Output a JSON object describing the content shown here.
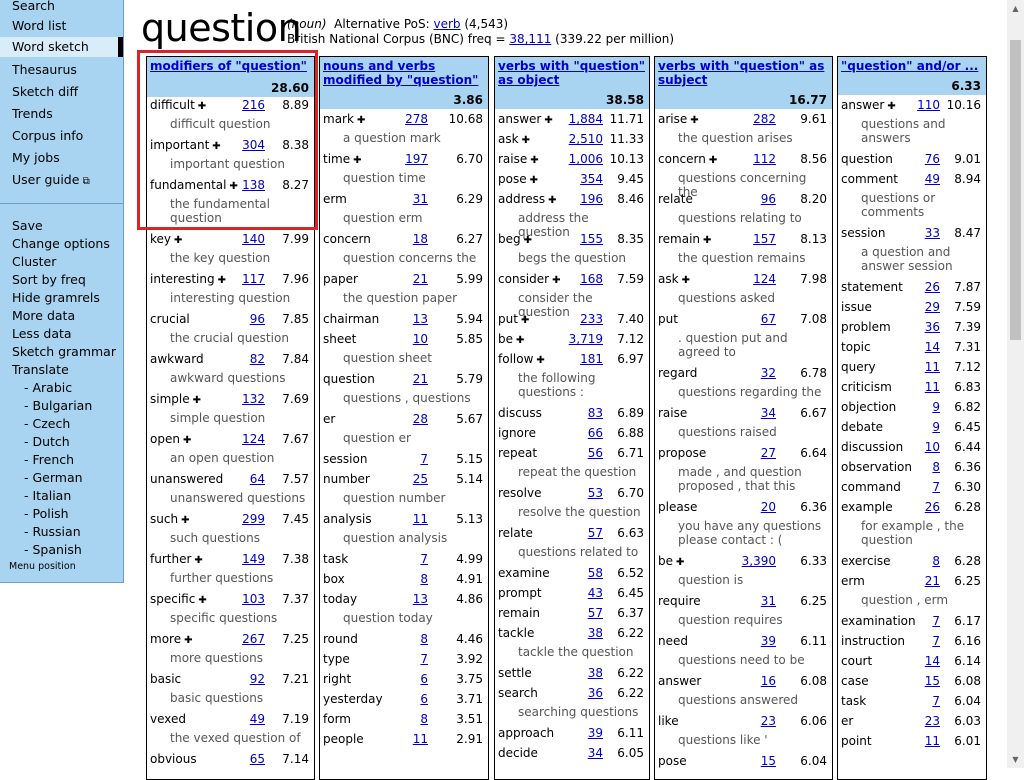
{
  "sidebar": {
    "top_items": [
      "Search",
      "Word list",
      "Word sketch",
      "Thesaurus",
      "Sketch diff",
      "Trends",
      "Corpus info",
      "My jobs",
      "User guide"
    ],
    "active": "Word sketch",
    "bottom_items": [
      "Save",
      "Change options",
      "Cluster",
      "Sort by freq",
      "Hide gramrels",
      "More data",
      "Less data",
      "Sketch grammar",
      "Translate"
    ],
    "languages": [
      "- Arabic",
      "- Bulgarian",
      "- Czech",
      "- Dutch",
      "- French",
      "- German",
      "- Italian",
      "- Polish",
      "- Russian",
      "- Spanish"
    ],
    "menu_position": "Menu position"
  },
  "header": {
    "headword": "question",
    "pos": "(noun)",
    "alt_pos_label": "Alternative PoS:",
    "alt_pos_link": "verb",
    "alt_pos_count": "(4,543)",
    "corpus_label": "British National Corpus (BNC) freq =",
    "freq": "38,111",
    "per_million": "(339.22 per million)"
  },
  "columns": [
    {
      "title": "modifiers of \"question\"",
      "score": "28.60",
      "rows": [
        {
          "word": "difficult",
          "plus": true,
          "freq": "216",
          "score": "8.89",
          "ex": "difficult question"
        },
        {
          "word": "important",
          "plus": true,
          "freq": "304",
          "score": "8.38",
          "ex": "important question"
        },
        {
          "word": "fundamental",
          "plus": true,
          "freq": "138",
          "score": "8.27",
          "ex": "the fundamental question"
        },
        {
          "word": "key",
          "plus": true,
          "freq": "140",
          "score": "7.99",
          "ex": "the key question"
        },
        {
          "word": "interesting",
          "plus": true,
          "freq": "117",
          "score": "7.96",
          "ex": "interesting question"
        },
        {
          "word": "crucial",
          "plus": false,
          "freq": "96",
          "score": "7.85",
          "ex": "the crucial question"
        },
        {
          "word": "awkward",
          "plus": false,
          "freq": "82",
          "score": "7.84",
          "ex": "awkward questions"
        },
        {
          "word": "simple",
          "plus": true,
          "freq": "132",
          "score": "7.69",
          "ex": "simple question"
        },
        {
          "word": "open",
          "plus": true,
          "freq": "124",
          "score": "7.67",
          "ex": "an open question"
        },
        {
          "word": "unanswered",
          "plus": false,
          "freq": "64",
          "score": "7.57",
          "ex": "unanswered questions ."
        },
        {
          "word": "such",
          "plus": true,
          "freq": "299",
          "score": "7.45",
          "ex": "such questions"
        },
        {
          "word": "further",
          "plus": true,
          "freq": "149",
          "score": "7.38",
          "ex": "further questions"
        },
        {
          "word": "specific",
          "plus": true,
          "freq": "103",
          "score": "7.37",
          "ex": "specific questions"
        },
        {
          "word": "more",
          "plus": true,
          "freq": "267",
          "score": "7.25",
          "ex": "more questions"
        },
        {
          "word": "basic",
          "plus": false,
          "freq": "92",
          "score": "7.21",
          "ex": "basic questions"
        },
        {
          "word": "vexed",
          "plus": false,
          "freq": "49",
          "score": "7.19",
          "ex": "the vexed question of"
        },
        {
          "word": "obvious",
          "plus": false,
          "freq": "65",
          "score": "7.14",
          "ex": ""
        }
      ]
    },
    {
      "title": "nouns and verbs modified by \"question\"",
      "score": "3.86",
      "rows": [
        {
          "word": "mark",
          "plus": true,
          "freq": "278",
          "score": "10.68",
          "ex": "a question mark"
        },
        {
          "word": "time",
          "plus": true,
          "freq": "197",
          "score": "6.70",
          "ex": "question time"
        },
        {
          "word": "erm",
          "plus": false,
          "freq": "31",
          "score": "6.29",
          "ex": "question erm"
        },
        {
          "word": "concern",
          "plus": false,
          "freq": "18",
          "score": "6.27",
          "ex": "question concerns the"
        },
        {
          "word": "paper",
          "plus": false,
          "freq": "21",
          "score": "5.99",
          "ex": "the question paper"
        },
        {
          "word": "chairman",
          "plus": false,
          "freq": "13",
          "score": "5.94",
          "ex": ""
        },
        {
          "word": "sheet",
          "plus": false,
          "freq": "10",
          "score": "5.85",
          "ex": "question sheet"
        },
        {
          "word": "question",
          "plus": false,
          "freq": "21",
          "score": "5.79",
          "ex": "questions , questions"
        },
        {
          "word": "er",
          "plus": false,
          "freq": "28",
          "score": "5.67",
          "ex": "question er"
        },
        {
          "word": "session",
          "plus": false,
          "freq": "7",
          "score": "5.15",
          "ex": ""
        },
        {
          "word": "number",
          "plus": false,
          "freq": "25",
          "score": "5.14",
          "ex": "question number"
        },
        {
          "word": "analysis",
          "plus": false,
          "freq": "11",
          "score": "5.13",
          "ex": "question analysis"
        },
        {
          "word": "task",
          "plus": false,
          "freq": "7",
          "score": "4.99",
          "ex": ""
        },
        {
          "word": "box",
          "plus": false,
          "freq": "8",
          "score": "4.91",
          "ex": ""
        },
        {
          "word": "today",
          "plus": false,
          "freq": "13",
          "score": "4.86",
          "ex": "question today"
        },
        {
          "word": "round",
          "plus": false,
          "freq": "8",
          "score": "4.46",
          "ex": ""
        },
        {
          "word": "type",
          "plus": false,
          "freq": "7",
          "score": "3.92",
          "ex": ""
        },
        {
          "word": "right",
          "plus": false,
          "freq": "6",
          "score": "3.75",
          "ex": ""
        },
        {
          "word": "yesterday",
          "plus": false,
          "freq": "6",
          "score": "3.71",
          "ex": ""
        },
        {
          "word": "form",
          "plus": false,
          "freq": "8",
          "score": "3.51",
          "ex": ""
        },
        {
          "word": "people",
          "plus": false,
          "freq": "11",
          "score": "2.91",
          "ex": ""
        }
      ]
    },
    {
      "title": "verbs with \"question\" as object",
      "score": "38.58",
      "rows": [
        {
          "word": "answer",
          "plus": true,
          "freq": "1,884",
          "score": "11.71",
          "ex": ""
        },
        {
          "word": "ask",
          "plus": true,
          "freq": "2,510",
          "score": "11.33",
          "ex": ""
        },
        {
          "word": "raise",
          "plus": true,
          "freq": "1,006",
          "score": "10.13",
          "ex": ""
        },
        {
          "word": "pose",
          "plus": true,
          "freq": "354",
          "score": "9.45",
          "ex": ""
        },
        {
          "word": "address",
          "plus": true,
          "freq": "196",
          "score": "8.46",
          "ex": "address the question"
        },
        {
          "word": "beg",
          "plus": true,
          "freq": "155",
          "score": "8.35",
          "ex": "begs the question"
        },
        {
          "word": "consider",
          "plus": true,
          "freq": "168",
          "score": "7.59",
          "ex": "consider the question"
        },
        {
          "word": "put",
          "plus": true,
          "freq": "233",
          "score": "7.40",
          "ex": ""
        },
        {
          "word": "be",
          "plus": true,
          "freq": "3,719",
          "score": "7.12",
          "ex": ""
        },
        {
          "word": "follow",
          "plus": true,
          "freq": "181",
          "score": "6.97",
          "ex": "the following questions :"
        },
        {
          "word": "discuss",
          "plus": false,
          "freq": "83",
          "score": "6.89",
          "ex": ""
        },
        {
          "word": "ignore",
          "plus": false,
          "freq": "66",
          "score": "6.88",
          "ex": ""
        },
        {
          "word": "repeat",
          "plus": false,
          "freq": "56",
          "score": "6.71",
          "ex": "repeat the question"
        },
        {
          "word": "resolve",
          "plus": false,
          "freq": "53",
          "score": "6.70",
          "ex": "resolve the question"
        },
        {
          "word": "relate",
          "plus": false,
          "freq": "57",
          "score": "6.63",
          "ex": "questions related to"
        },
        {
          "word": "examine",
          "plus": false,
          "freq": "58",
          "score": "6.52",
          "ex": ""
        },
        {
          "word": "prompt",
          "plus": false,
          "freq": "43",
          "score": "6.45",
          "ex": ""
        },
        {
          "word": "remain",
          "plus": false,
          "freq": "57",
          "score": "6.37",
          "ex": ""
        },
        {
          "word": "tackle",
          "plus": false,
          "freq": "38",
          "score": "6.22",
          "ex": "tackle the question"
        },
        {
          "word": "settle",
          "plus": false,
          "freq": "38",
          "score": "6.22",
          "ex": ""
        },
        {
          "word": "search",
          "plus": false,
          "freq": "36",
          "score": "6.22",
          "ex": "searching questions"
        },
        {
          "word": "approach",
          "plus": false,
          "freq": "39",
          "score": "6.11",
          "ex": ""
        },
        {
          "word": "decide",
          "plus": false,
          "freq": "34",
          "score": "6.05",
          "ex": ""
        }
      ]
    },
    {
      "title": "verbs with \"question\" as subject",
      "score": "16.77",
      "rows": [
        {
          "word": "arise",
          "plus": true,
          "freq": "282",
          "score": "9.61",
          "ex": "the question arises"
        },
        {
          "word": "concern",
          "plus": true,
          "freq": "112",
          "score": "8.56",
          "ex": "questions concerning the"
        },
        {
          "word": "relate",
          "plus": false,
          "freq": "96",
          "score": "8.20",
          "ex": "questions relating to"
        },
        {
          "word": "remain",
          "plus": true,
          "freq": "157",
          "score": "8.13",
          "ex": "the question remains"
        },
        {
          "word": "ask",
          "plus": true,
          "freq": "124",
          "score": "7.98",
          "ex": "questions asked"
        },
        {
          "word": "put",
          "plus": false,
          "freq": "67",
          "score": "7.08",
          "ex": ". question put and agreed to"
        },
        {
          "word": "regard",
          "plus": false,
          "freq": "32",
          "score": "6.78",
          "ex": "questions regarding the"
        },
        {
          "word": "raise",
          "plus": false,
          "freq": "34",
          "score": "6.67",
          "ex": "questions raised"
        },
        {
          "word": "propose",
          "plus": false,
          "freq": "27",
          "score": "6.64",
          "ex": "made , and question proposed , that this"
        },
        {
          "word": "please",
          "plus": false,
          "freq": "20",
          "score": "6.36",
          "ex": "you have any questions please contact : ("
        },
        {
          "word": "be",
          "plus": true,
          "freq": "3,390",
          "score": "6.33",
          "ex": "question is"
        },
        {
          "word": "require",
          "plus": false,
          "freq": "31",
          "score": "6.25",
          "ex": "question requires"
        },
        {
          "word": "need",
          "plus": false,
          "freq": "39",
          "score": "6.11",
          "ex": "questions need to be"
        },
        {
          "word": "answer",
          "plus": false,
          "freq": "16",
          "score": "6.08",
          "ex": "questions answered"
        },
        {
          "word": "like",
          "plus": false,
          "freq": "23",
          "score": "6.06",
          "ex": "questions like '"
        },
        {
          "word": "pose",
          "plus": false,
          "freq": "15",
          "score": "6.04",
          "ex": ""
        }
      ]
    },
    {
      "title": "\"question\" and/or ...",
      "score": "6.33",
      "rows": [
        {
          "word": "answer",
          "plus": true,
          "freq": "110",
          "score": "10.16",
          "ex": "questions and answers"
        },
        {
          "word": "question",
          "plus": false,
          "freq": "76",
          "score": "9.01",
          "ex": ""
        },
        {
          "word": "comment",
          "plus": false,
          "freq": "49",
          "score": "8.94",
          "ex": "questions or comments"
        },
        {
          "word": "session",
          "plus": false,
          "freq": "33",
          "score": "8.47",
          "ex": "a question and answer session"
        },
        {
          "word": "statement",
          "plus": false,
          "freq": "26",
          "score": "7.87",
          "ex": ""
        },
        {
          "word": "issue",
          "plus": false,
          "freq": "29",
          "score": "7.59",
          "ex": ""
        },
        {
          "word": "problem",
          "plus": false,
          "freq": "36",
          "score": "7.39",
          "ex": ""
        },
        {
          "word": "topic",
          "plus": false,
          "freq": "14",
          "score": "7.31",
          "ex": ""
        },
        {
          "word": "query",
          "plus": false,
          "freq": "11",
          "score": "7.12",
          "ex": ""
        },
        {
          "word": "criticism",
          "plus": false,
          "freq": "11",
          "score": "6.83",
          "ex": ""
        },
        {
          "word": "objection",
          "plus": false,
          "freq": "9",
          "score": "6.82",
          "ex": ""
        },
        {
          "word": "debate",
          "plus": false,
          "freq": "9",
          "score": "6.45",
          "ex": ""
        },
        {
          "word": "discussion",
          "plus": false,
          "freq": "10",
          "score": "6.44",
          "ex": ""
        },
        {
          "word": "observation",
          "plus": false,
          "freq": "8",
          "score": "6.36",
          "ex": ""
        },
        {
          "word": "command",
          "plus": false,
          "freq": "7",
          "score": "6.30",
          "ex": ""
        },
        {
          "word": "example",
          "plus": false,
          "freq": "26",
          "score": "6.28",
          "ex": "for example , the question"
        },
        {
          "word": "exercise",
          "plus": false,
          "freq": "8",
          "score": "6.28",
          "ex": ""
        },
        {
          "word": "erm",
          "plus": false,
          "freq": "21",
          "score": "6.25",
          "ex": "question , erm"
        },
        {
          "word": "examination",
          "plus": false,
          "freq": "7",
          "score": "6.17",
          "ex": ""
        },
        {
          "word": "instruction",
          "plus": false,
          "freq": "7",
          "score": "6.16",
          "ex": ""
        },
        {
          "word": "court",
          "plus": false,
          "freq": "14",
          "score": "6.14",
          "ex": ""
        },
        {
          "word": "case",
          "plus": false,
          "freq": "15",
          "score": "6.08",
          "ex": ""
        },
        {
          "word": "task",
          "plus": false,
          "freq": "7",
          "score": "6.04",
          "ex": ""
        },
        {
          "word": "er",
          "plus": false,
          "freq": "23",
          "score": "6.03",
          "ex": ""
        },
        {
          "word": "point",
          "plus": false,
          "freq": "11",
          "score": "6.01",
          "ex": ""
        }
      ]
    }
  ],
  "colors": {
    "sidebar_bg": "#a8d4f2",
    "link": "#0000cc",
    "highlight": "#d9242a"
  }
}
